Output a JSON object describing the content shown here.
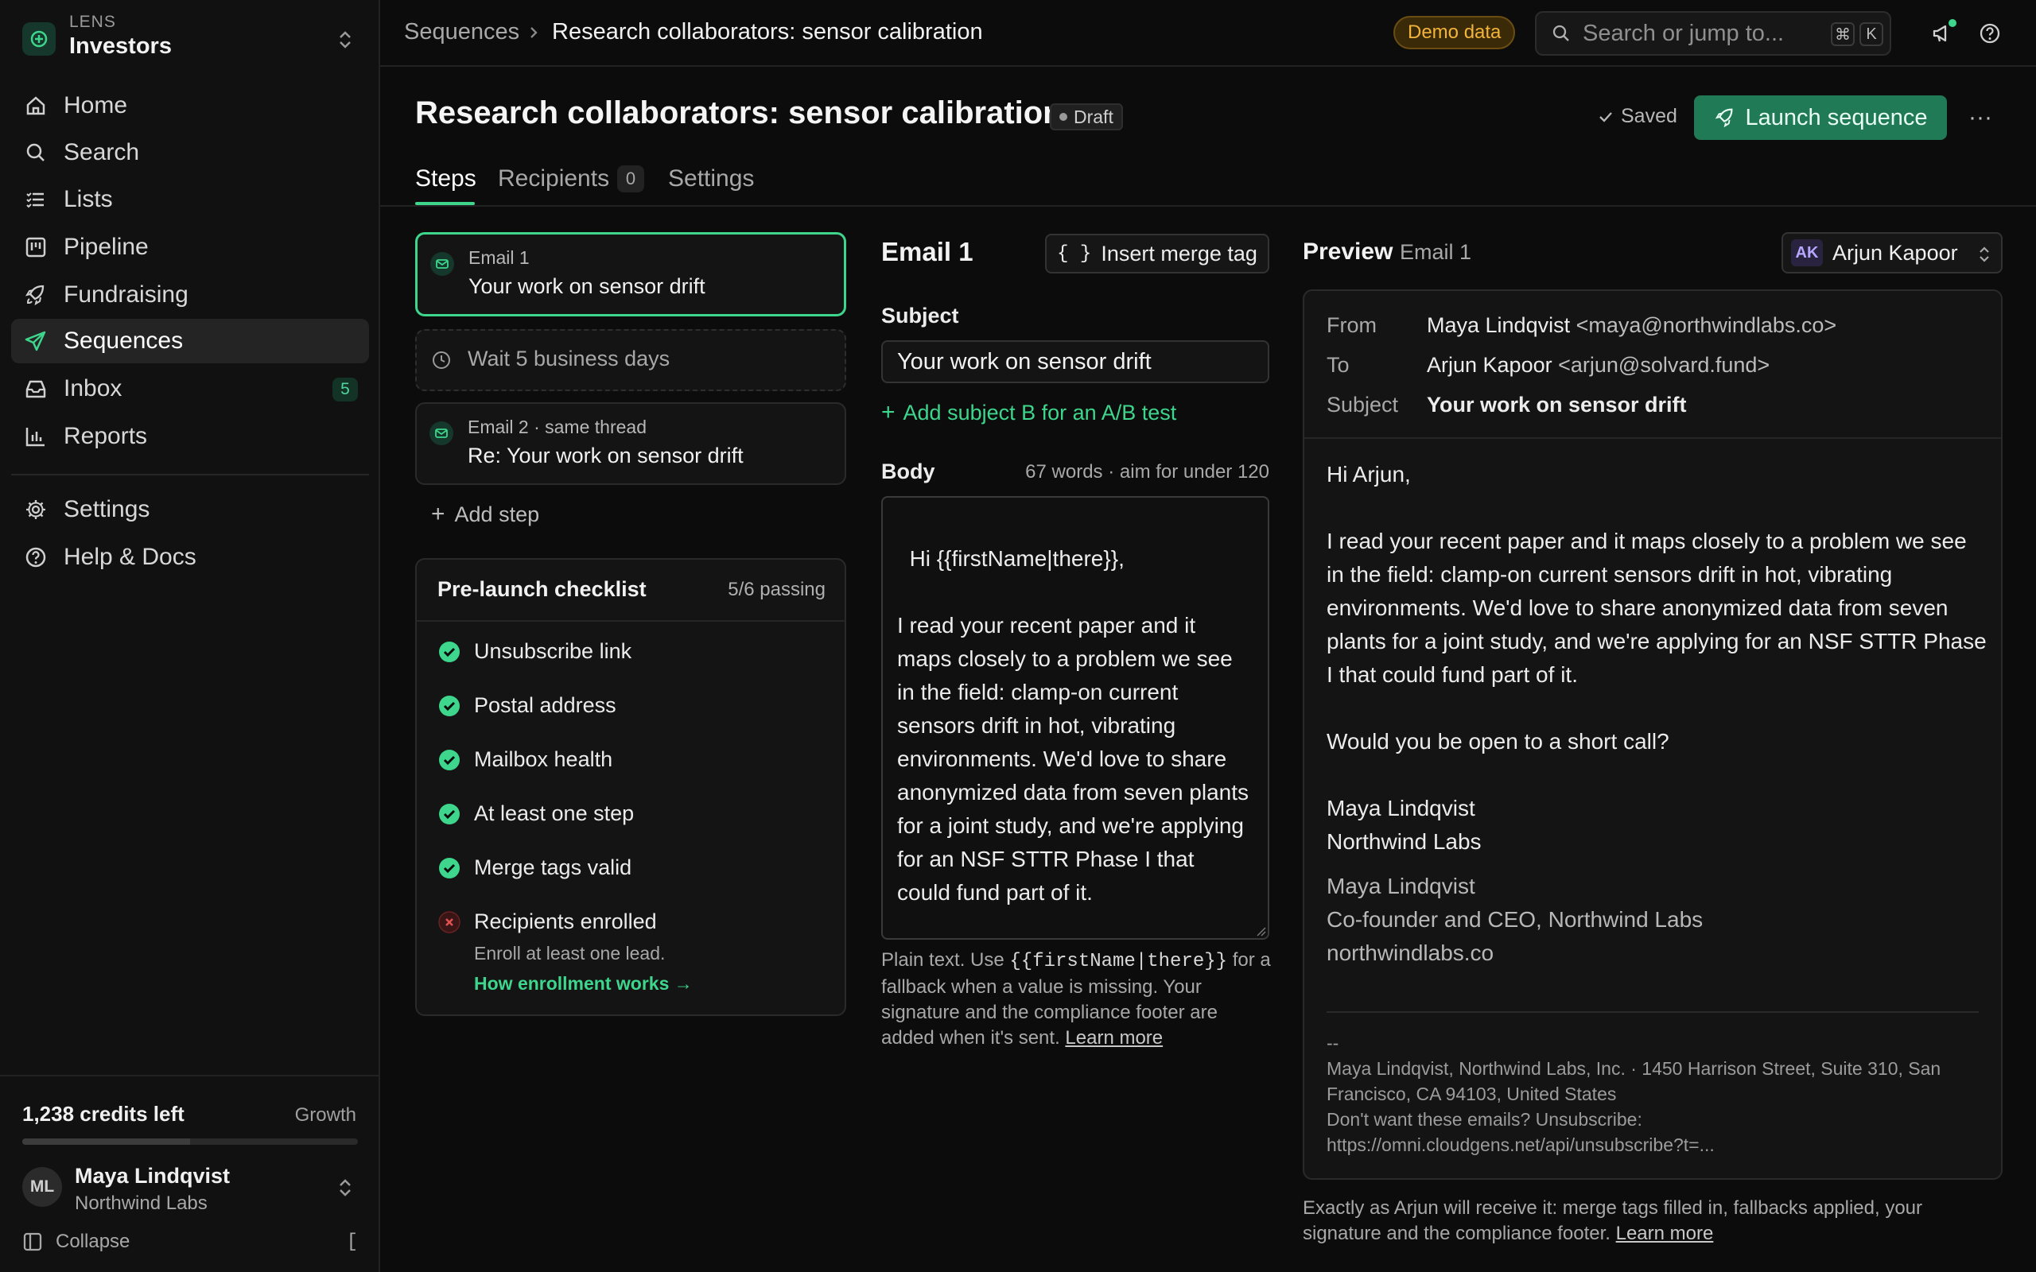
{
  "workspace": {
    "brand": "LENS",
    "name": "Investors"
  },
  "sidebar": {
    "items": [
      {
        "label": "Home",
        "icon": "home-icon"
      },
      {
        "label": "Search",
        "icon": "search-icon"
      },
      {
        "label": "Lists",
        "icon": "list-icon"
      },
      {
        "label": "Pipeline",
        "icon": "kanban-icon"
      },
      {
        "label": "Fundraising",
        "icon": "rocket-icon"
      },
      {
        "label": "Sequences",
        "icon": "send-icon",
        "active": true
      },
      {
        "label": "Inbox",
        "icon": "inbox-icon",
        "badge": "5"
      },
      {
        "label": "Reports",
        "icon": "bar-chart-icon"
      }
    ],
    "secondary": [
      {
        "label": "Settings",
        "icon": "gear-icon"
      },
      {
        "label": "Help & Docs",
        "icon": "help-circle-icon"
      }
    ],
    "credits": "1,238 credits left",
    "credits_used_fraction": 0.5,
    "plan": "Growth",
    "user": {
      "initials": "ML",
      "name": "Maya Lindqvist",
      "org": "Northwind Labs"
    },
    "collapse_label": "Collapse",
    "collapse_shortcut": "["
  },
  "topbar": {
    "breadcrumb_root": "Sequences",
    "breadcrumb_current": "Research collaborators: sensor calibration",
    "demo_badge": "Demo data",
    "search_placeholder": "Search or jump to...",
    "shortcut_keys": [
      "⌘",
      "K"
    ]
  },
  "page": {
    "title": "Research collaborators: sensor calibration",
    "status": "Draft",
    "saved_label": "Saved",
    "launch_label": "Launch sequence",
    "more_label": "···",
    "tabs": [
      {
        "label": "Steps",
        "active": true
      },
      {
        "label": "Recipients",
        "count": "0"
      },
      {
        "label": "Settings"
      }
    ]
  },
  "steps": [
    {
      "kicker": "Email 1",
      "subject": "Your work on sensor drift",
      "selected": true
    },
    {
      "wait": "Wait 5 business days"
    },
    {
      "kicker": "Email 2 · same thread",
      "subject": "Re: Your work on sensor drift"
    }
  ],
  "add_step_label": "Add step",
  "checklist": {
    "title": "Pre-launch checklist",
    "count": "5/6 passing",
    "items": [
      {
        "label": "Unsubscribe link",
        "status": "pass"
      },
      {
        "label": "Postal address",
        "status": "pass"
      },
      {
        "label": "Mailbox health",
        "status": "pass"
      },
      {
        "label": "At least one step",
        "status": "pass"
      },
      {
        "label": "Merge tags valid",
        "status": "pass"
      },
      {
        "label": "Recipients enrolled",
        "status": "fail",
        "hint": "Enroll at least one lead.",
        "link": "How enrollment works →"
      }
    ]
  },
  "editor": {
    "title": "Email 1",
    "merge_tag_label": "Insert merge tag",
    "merge_tag_icon": "{ }",
    "subject_label": "Subject",
    "subject_value": "Your work on sensor drift",
    "ab_label": "Add subject B for an A/B test",
    "body_label": "Body",
    "word_count": "67 words · aim for under 120",
    "body": "Hi {{firstName|there}},\n\nI read your recent paper and it maps closely to a problem we see in the field: clamp-on current sensors drift in hot, vibrating environments. We'd love to share anonymized data from seven plants for a joint study, and we're applying for an NSF STTR Phase I that could fund part of it.\n\nWould you be open to a short call?",
    "help_pre": "Plain text. Use ",
    "help_code": "{{firstName|there}}",
    "help_post": " for a fallback when a value is missing. Your signature and the compliance footer are added when it's sent. ",
    "help_link": "Learn more"
  },
  "preview": {
    "title": "Preview",
    "subtitle": "Email 1",
    "recipient_initials": "AK",
    "recipient_name": "Arjun Kapoor",
    "from_label": "From",
    "from_name": "Maya Lindqvist",
    "from_email": "<maya@northwindlabs.co>",
    "to_label": "To",
    "to_name": "Arjun Kapoor",
    "to_email": "<arjun@solvard.fund>",
    "subject_label": "Subject",
    "subject": "Your work on sensor drift",
    "greeting": "Hi Arjun,",
    "paragraph": "I read your recent paper and it maps closely to a problem we see in the field: clamp-on current sensors drift in hot, vibrating environments. We'd love to share anonymized data from seven plants for a joint study, and we're applying for an NSF STTR Phase I that could fund part of it.",
    "question": "Would you be open to a short call?",
    "signoff_name": "Maya Lindqvist",
    "signoff_org": "Northwind Labs",
    "sig_name": "Maya Lindqvist",
    "sig_title": "Co-founder and CEO, Northwind Labs",
    "sig_site": "northwindlabs.co",
    "footer_dashes": "--",
    "footer_address": "Maya Lindqvist, Northwind Labs, Inc. · 1450 Harrison Street, Suite 310, San Francisco, CA 94103, United States",
    "footer_unsub": "Don't want these emails? Unsubscribe:",
    "footer_url": "https://omni.cloudgens.net/api/unsubscribe?t=...",
    "note": "Exactly as Arjun will receive it: merge tags filled in, fallbacks applied, your signature and the compliance footer. ",
    "note_link": "Learn more"
  },
  "colors": {
    "accent": "#3dd68c",
    "launch": "#1f7a55",
    "error": "#e05252",
    "demo": "#f2b43a"
  }
}
